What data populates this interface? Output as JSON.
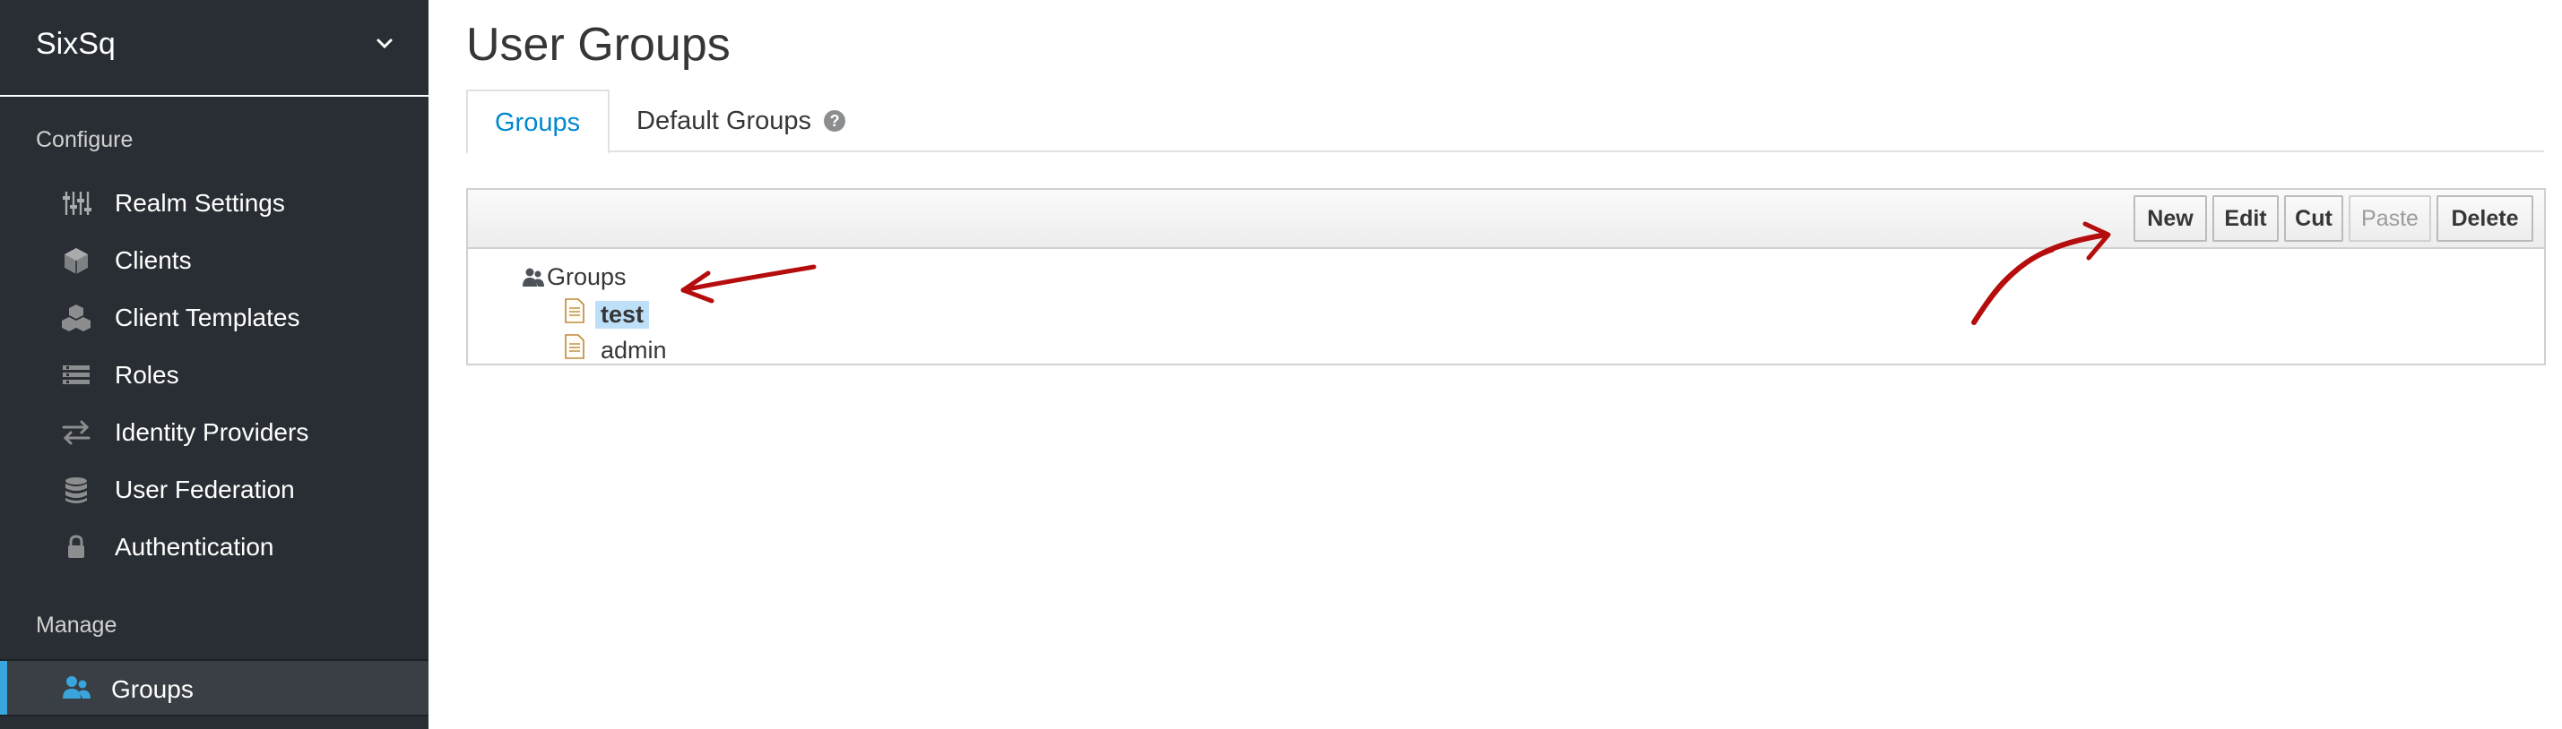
{
  "sidebar": {
    "realm_name": "SixSq",
    "configure_title": "Configure",
    "manage_title": "Manage",
    "configure_items": [
      {
        "label": "Realm Settings",
        "icon": "sliders-icon"
      },
      {
        "label": "Clients",
        "icon": "cube-icon"
      },
      {
        "label": "Client Templates",
        "icon": "cubes-icon"
      },
      {
        "label": "Roles",
        "icon": "list-icon"
      },
      {
        "label": "Identity Providers",
        "icon": "exchange-icon"
      },
      {
        "label": "User Federation",
        "icon": "database-icon"
      },
      {
        "label": "Authentication",
        "icon": "lock-icon"
      }
    ],
    "manage_items": [
      {
        "label": "Groups",
        "icon": "users-icon",
        "active": true
      }
    ]
  },
  "main": {
    "title": "User Groups",
    "tabs": [
      {
        "label": "Groups",
        "active": true
      },
      {
        "label": "Default Groups",
        "help": "?"
      }
    ],
    "toolbar": {
      "new_label": "New",
      "edit_label": "Edit",
      "cut_label": "Cut",
      "paste_label": "Paste",
      "delete_label": "Delete"
    },
    "tree": {
      "root": "Groups",
      "children": [
        {
          "label": "test",
          "selected": true
        },
        {
          "label": "admin",
          "selected": false
        }
      ]
    }
  },
  "colors": {
    "sidebar_bg": "#292e34",
    "active_accent": "#39a5dc",
    "tab_active": "#0088ce",
    "selection": "#bddff8",
    "annotation": "#b50d0d"
  }
}
